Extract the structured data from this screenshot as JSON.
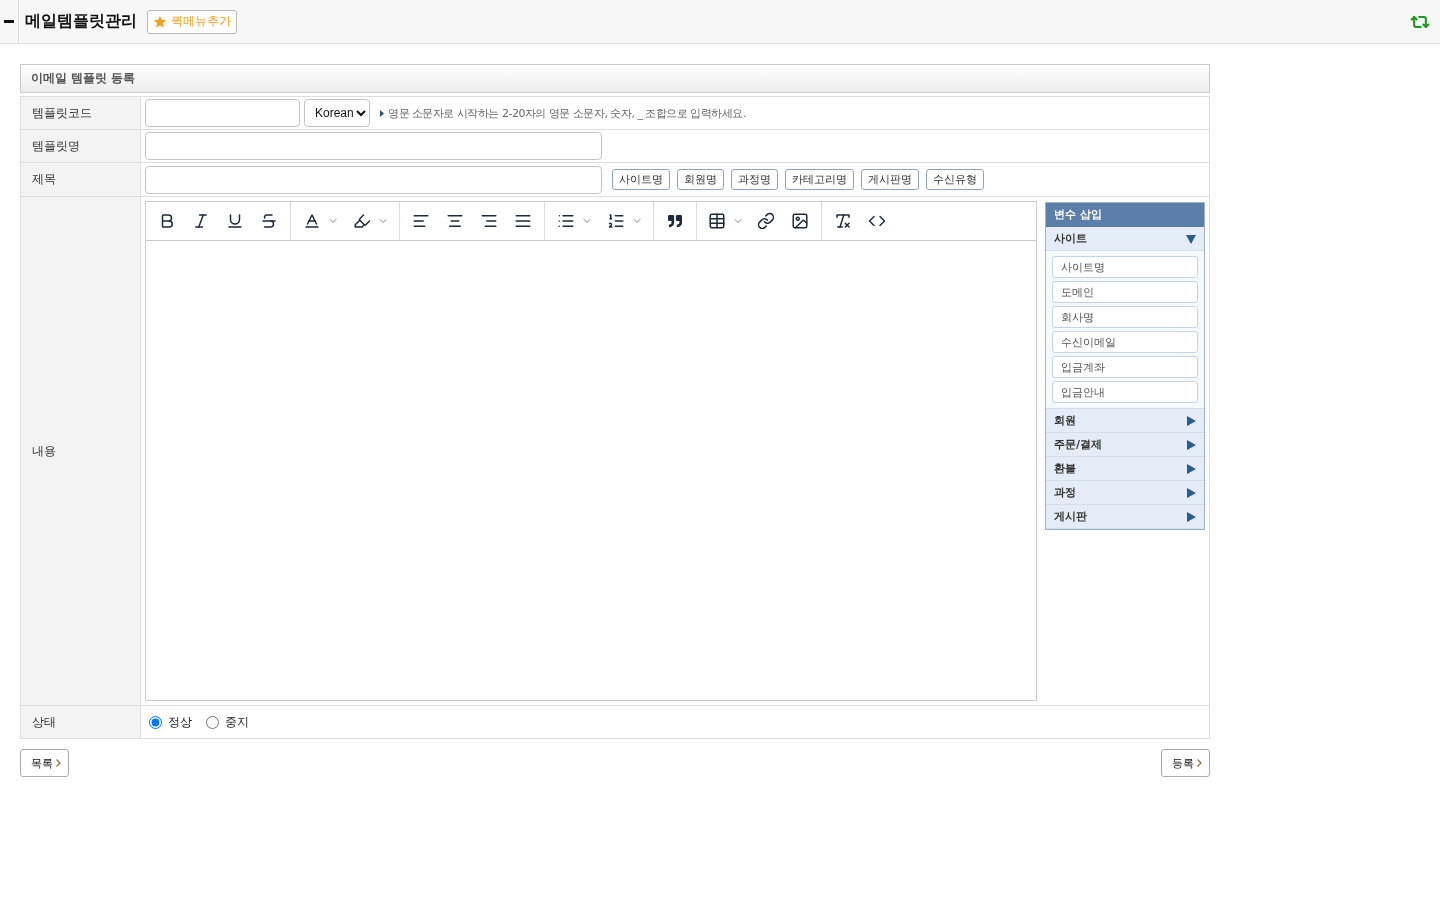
{
  "header": {
    "title": "메일템플릿관리",
    "quick_menu_button": "퀵메뉴추가"
  },
  "section_title": "이메일 템플릿 등록",
  "form": {
    "template_code": {
      "label": "템플릿코드",
      "language": "Korean",
      "hint": "영문 소문자로 시작하는 2-20자의 영문 소문자, 숫자, _ 조합으로 입력하세요."
    },
    "template_name": {
      "label": "템플릿명"
    },
    "subject": {
      "label": "제목",
      "insert_buttons": [
        "사이트명",
        "회원명",
        "과정명",
        "카테고리명",
        "게시판명",
        "수신유형"
      ]
    },
    "content": {
      "label": "내용",
      "variable_panel": {
        "title": "변수 삽입",
        "groups": [
          {
            "label": "사이트",
            "expanded": true,
            "items": [
              "사이트명",
              "도메인",
              "회사명",
              "수신이메일",
              "입금계좌",
              "입금안내"
            ]
          },
          {
            "label": "회원",
            "expanded": false
          },
          {
            "label": "주문/결제",
            "expanded": false
          },
          {
            "label": "환불",
            "expanded": false
          },
          {
            "label": "과정",
            "expanded": false
          },
          {
            "label": "게시판",
            "expanded": false
          }
        ]
      }
    },
    "status": {
      "label": "상태",
      "options": [
        {
          "label": "정상",
          "selected": true
        },
        {
          "label": "중지",
          "selected": false
        }
      ]
    }
  },
  "buttons": {
    "list": "목록",
    "register": "등록"
  }
}
